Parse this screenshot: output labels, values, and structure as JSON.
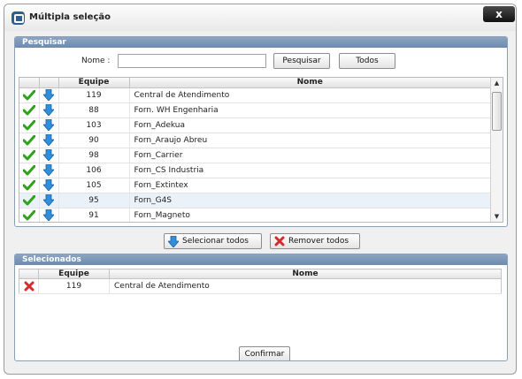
{
  "window": {
    "title": "Múltipla seleção",
    "close_label": "x"
  },
  "search_panel": {
    "header": "Pesquisar",
    "name_label": "Nome :",
    "name_value": "",
    "search_button": "Pesquisar",
    "all_button": "Todos"
  },
  "results_grid": {
    "columns": [
      "",
      "",
      "Equipe",
      "Nome"
    ],
    "rows": [
      {
        "equipe": "119",
        "nome": "Central de Atendimento",
        "selected": false
      },
      {
        "equipe": "88",
        "nome": "Forn. WH Engenharia",
        "selected": false
      },
      {
        "equipe": "103",
        "nome": "Forn_Adekua",
        "selected": false
      },
      {
        "equipe": "90",
        "nome": "Forn_Araujo Abreu",
        "selected": false
      },
      {
        "equipe": "98",
        "nome": "Forn_Carrier",
        "selected": false
      },
      {
        "equipe": "106",
        "nome": "Forn_CS Industria",
        "selected": false
      },
      {
        "equipe": "105",
        "nome": "Forn_Extintex",
        "selected": false
      },
      {
        "equipe": "95",
        "nome": "Forn_G4S",
        "selected": true
      },
      {
        "equipe": "91",
        "nome": "Forn_Magneto",
        "selected": false
      }
    ]
  },
  "actions": {
    "select_all": "Selecionar todos",
    "remove_all": "Remover todos"
  },
  "selected_panel": {
    "header": "Selecionados",
    "columns": [
      "",
      "Equipe",
      "Nome"
    ],
    "rows": [
      {
        "equipe": "119",
        "nome": "Central de Atendimento"
      }
    ]
  },
  "confirm_button": "Confirmar",
  "icons": {
    "check": "check-icon",
    "add": "arrow-down-icon",
    "remove": "red-x-icon"
  },
  "colors": {
    "header_blue": "#7a95b7",
    "check_green": "#2ea21a",
    "arrow_blue": "#2f8fdc",
    "remove_red": "#d62b2b"
  }
}
